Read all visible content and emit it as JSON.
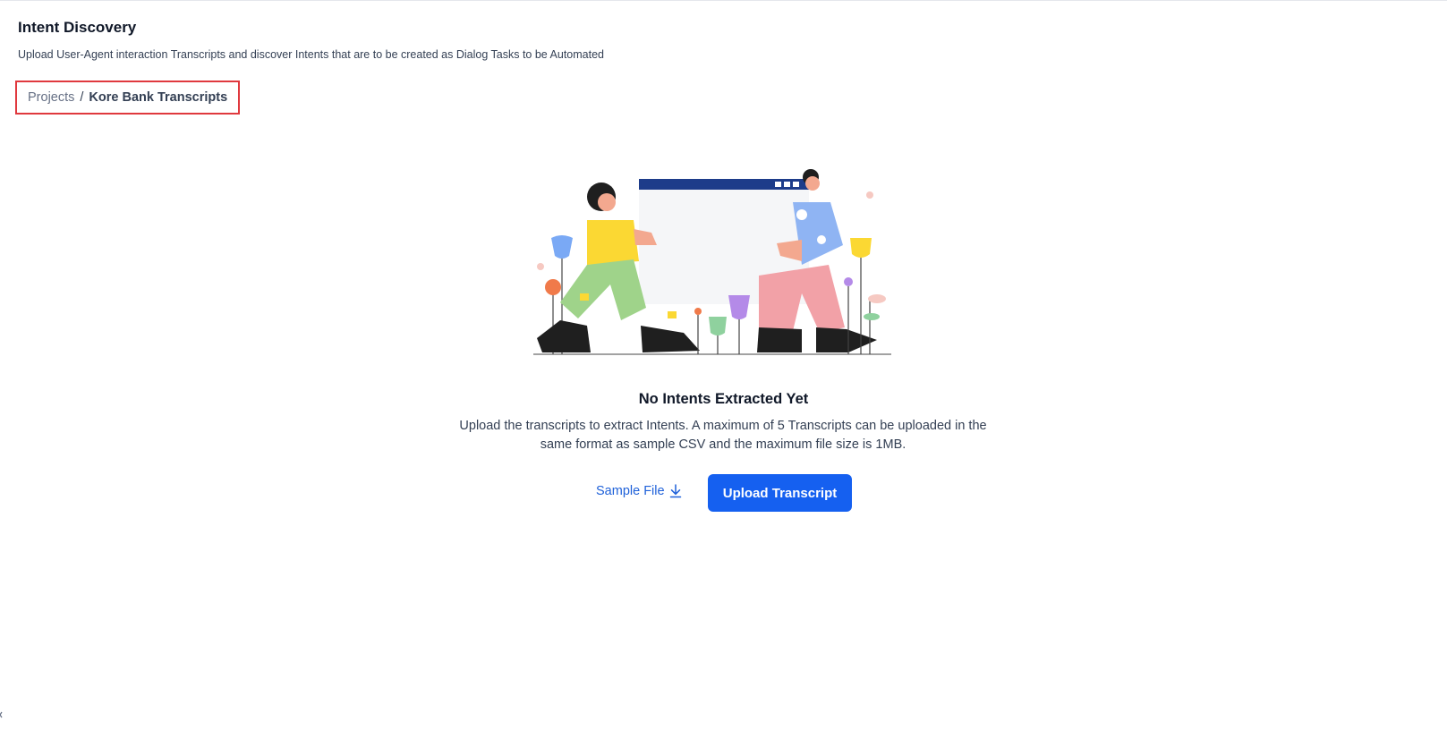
{
  "header": {
    "title": "Intent Discovery",
    "subtitle": "Upload User-Agent interaction Transcripts and discover Intents that are to be created as Dialog Tasks to be Automated"
  },
  "breadcrumb": {
    "parent": "Projects",
    "separator": "/",
    "current": "Kore Bank Transcripts"
  },
  "empty_state": {
    "illustration": "people-holding-window-illustration",
    "title": "No Intents Extracted Yet",
    "description": "Upload the transcripts to extract Intents. A maximum of 5 Transcripts can be uploaded in the same format as sample CSV and the maximum file size is 1MB."
  },
  "actions": {
    "sample_file_label": "Sample File",
    "sample_file_icon": "download-icon",
    "upload_label": "Upload Transcript"
  },
  "colors": {
    "primary": "#1560f0",
    "link": "#1f61d9",
    "highlight_border": "#e0393e"
  }
}
